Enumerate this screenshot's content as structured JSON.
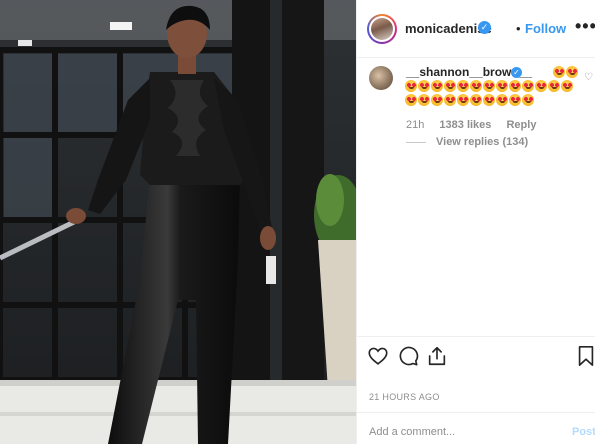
{
  "post": {
    "username": "monicadenise",
    "verified_mark": "✓",
    "separator": "•",
    "follow_label": "Follow",
    "more_icon": "•••"
  },
  "comment": {
    "username": "__shannon__brown__",
    "verified_mark": "✓",
    "emoji_name": "heart-eyes-emoji",
    "emoji_count": 25,
    "time": "21h",
    "likes": "1383 likes",
    "reply_label": "Reply",
    "view_replies": "View replies (134)"
  },
  "footer": {
    "timestamp": "21 HOURS AGO",
    "comment_placeholder": "Add a comment...",
    "post_label": "Post"
  },
  "colors": {
    "accent": "#3897f0",
    "muted": "#8e8e8e",
    "text": "#262626",
    "post_disabled": "#b3dbff"
  }
}
